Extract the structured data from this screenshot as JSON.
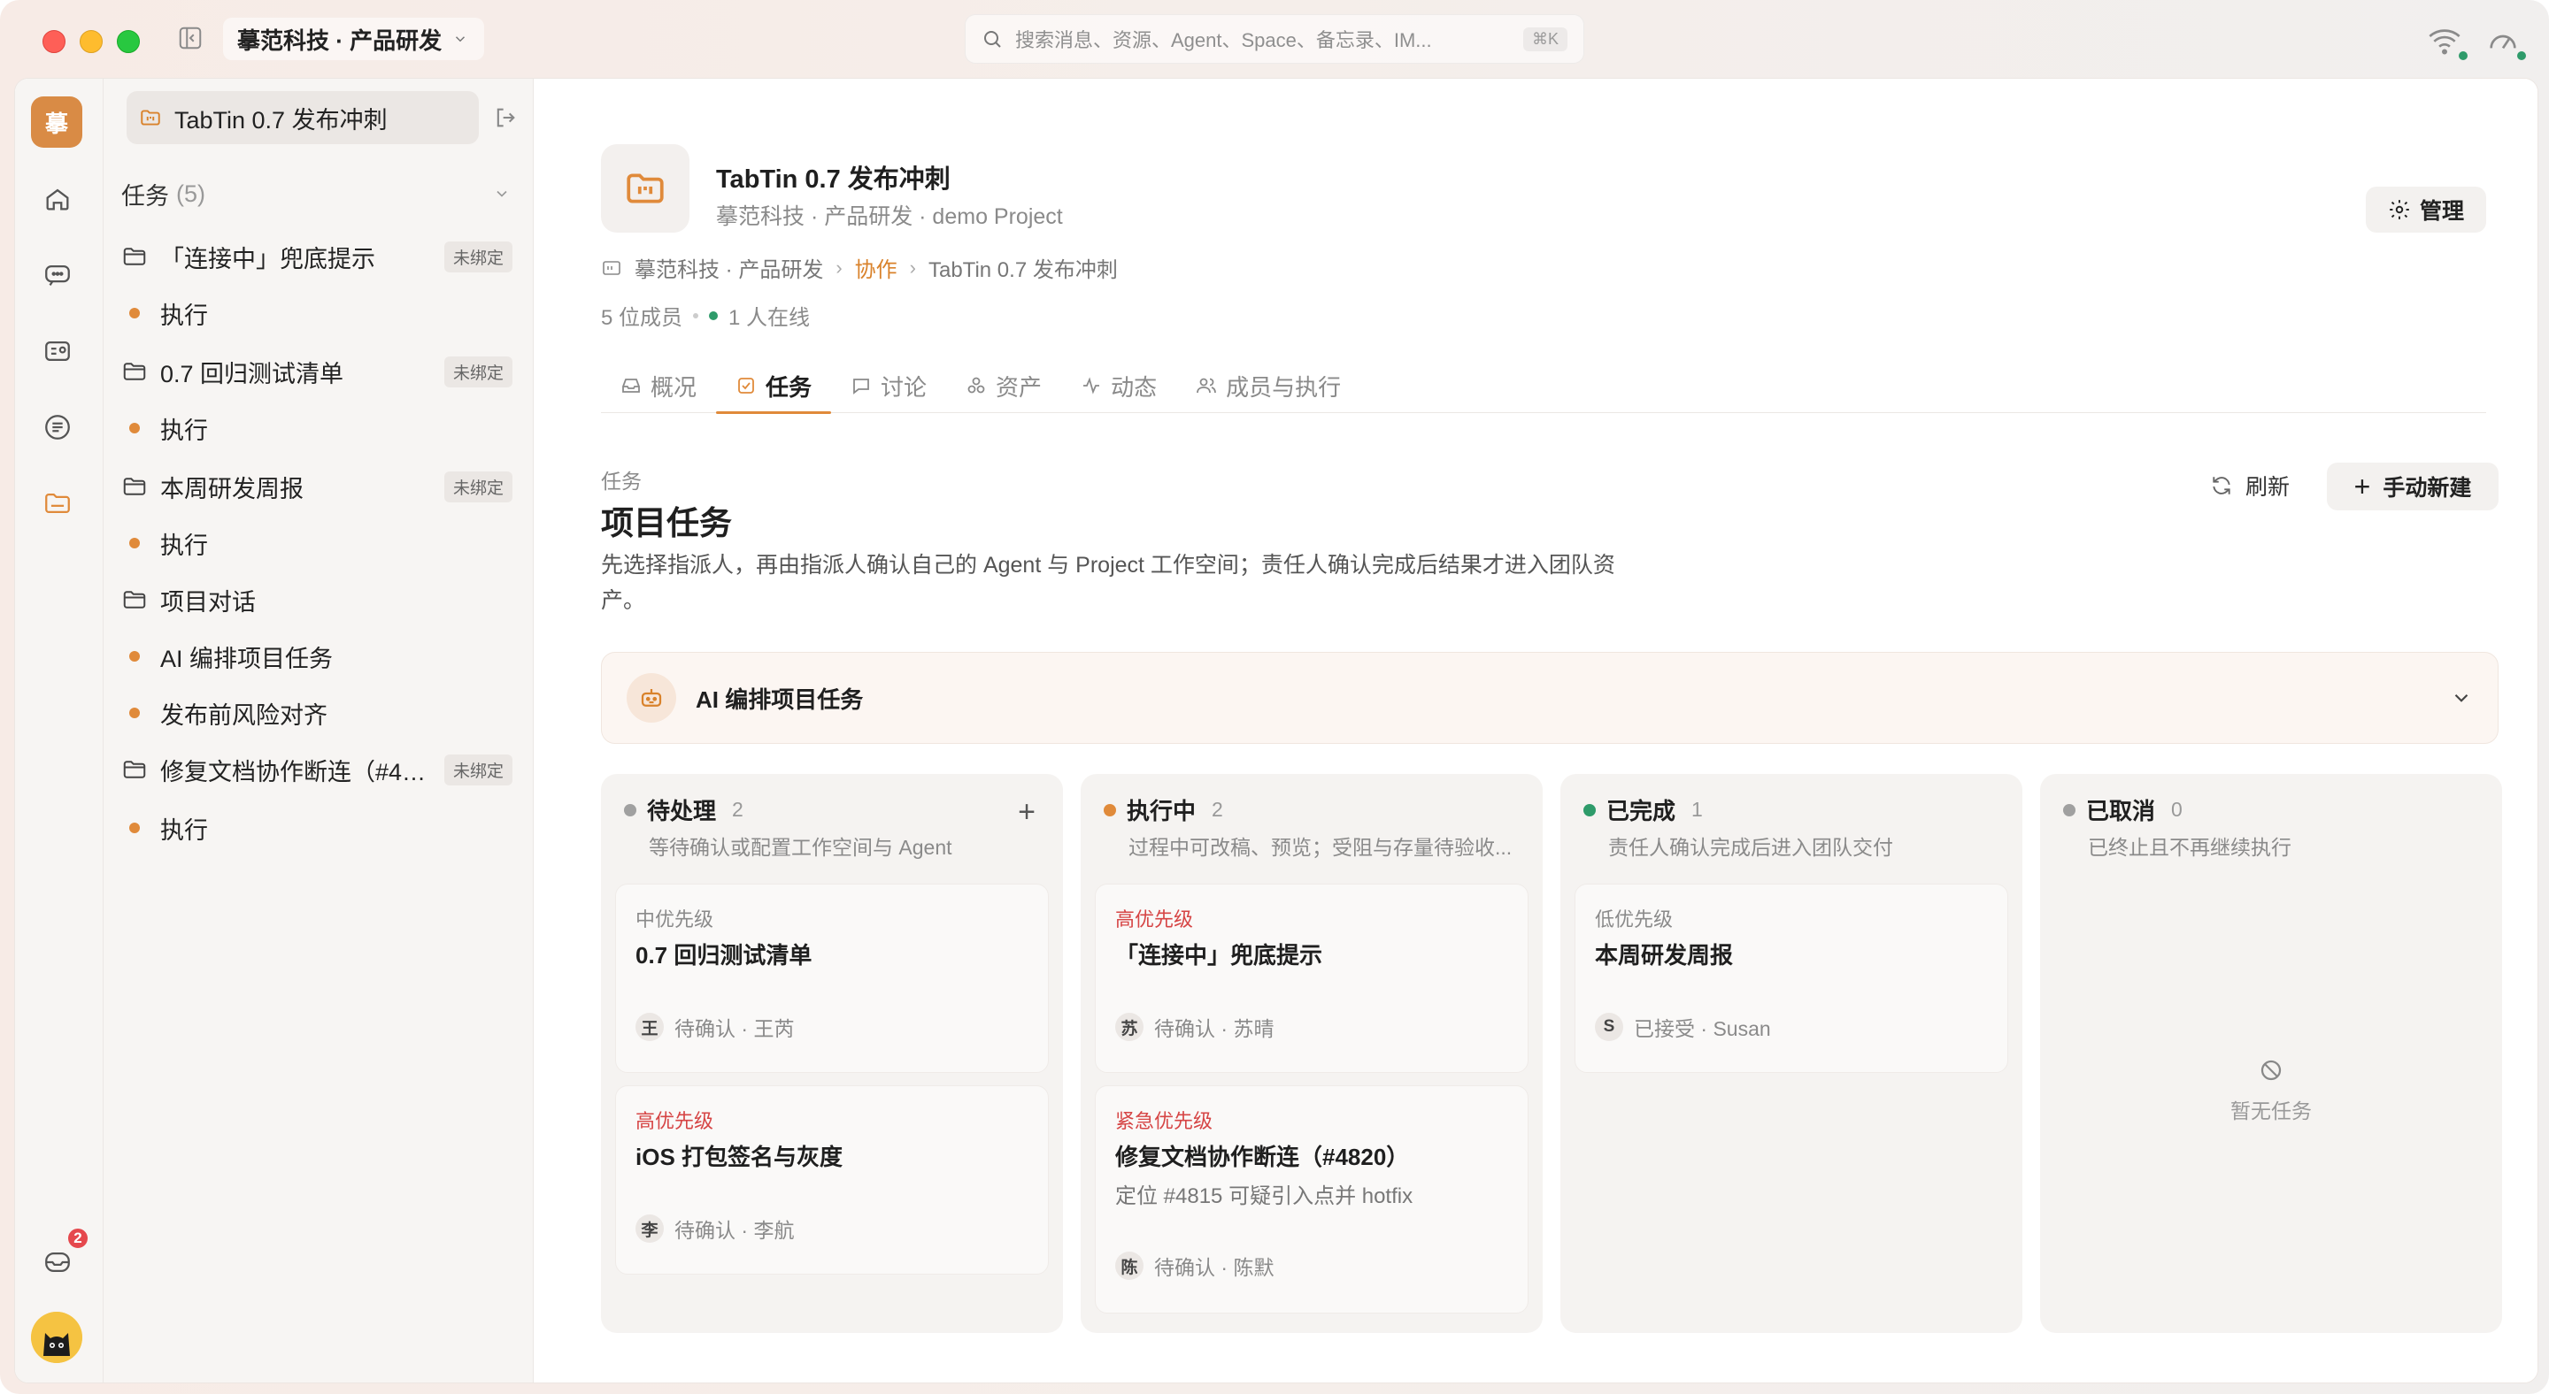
{
  "titlebar": {
    "workspace": "摹范科技 · 产品研发",
    "search_placeholder": "搜索消息、资源、Agent、Space、备忘录、IM...",
    "search_shortcut": "⌘K"
  },
  "rail": {
    "workspace_initial": "摹",
    "inbox_badge": "2"
  },
  "sidebar": {
    "project": "TabTin 0.7 发布冲刺",
    "section_label": "任务",
    "section_count": "(5)",
    "items": [
      {
        "type": "folder",
        "label": "「连接中」兜底提示",
        "tag": "未绑定"
      },
      {
        "type": "run",
        "label": "执行"
      },
      {
        "type": "folder",
        "label": "0.7 回归测试清单",
        "tag": "未绑定"
      },
      {
        "type": "run",
        "label": "执行"
      },
      {
        "type": "folder",
        "label": "本周研发周报",
        "tag": "未绑定"
      },
      {
        "type": "run",
        "label": "执行"
      },
      {
        "type": "folder",
        "label": "项目对话"
      },
      {
        "type": "run",
        "label": "AI 编排项目任务"
      },
      {
        "type": "run",
        "label": "发布前风险对齐"
      },
      {
        "type": "folder",
        "label": "修复文档协作断连（#4…",
        "tag": "未绑定"
      },
      {
        "type": "run",
        "label": "执行"
      }
    ]
  },
  "header": {
    "title": "TabTin 0.7 发布冲刺",
    "subtitle": "摹范科技 · 产品研发 · demo Project",
    "manage_label": "管理",
    "breadcrumb": [
      "摹范科技 · 产品研发",
      "协作",
      "TabTin 0.7 发布冲刺"
    ],
    "members": "5 位成员",
    "online": "1 人在线"
  },
  "tabs": [
    {
      "label": "概况",
      "icon": "inbox-icon"
    },
    {
      "label": "任务",
      "icon": "checkbox-icon",
      "active": true
    },
    {
      "label": "讨论",
      "icon": "chat-icon"
    },
    {
      "label": "资产",
      "icon": "assets-icon"
    },
    {
      "label": "动态",
      "icon": "activity-icon"
    },
    {
      "label": "成员与执行",
      "icon": "members-icon"
    }
  ],
  "tasks_section": {
    "kicker": "任务",
    "title": "项目任务",
    "description": "先选择指派人，再由指派人确认自己的 Agent 与 Project 工作空间；责任人确认完成后结果才进入团队资产。",
    "refresh_label": "刷新",
    "new_label": "手动新建"
  },
  "ai_panel": {
    "label": "AI 编排项目任务"
  },
  "columns": [
    {
      "name": "待处理",
      "count": "2",
      "color": "#a0a0a0",
      "desc": "等待确认或配置工作空间与 Agent",
      "cards": [
        {
          "priority": "中优先级",
          "prio_class": "p-mid",
          "title": "0.7 回归测试清单",
          "avatar": "王",
          "status": "待确认 · 王芮"
        },
        {
          "priority": "高优先级",
          "prio_class": "p-high",
          "title": "iOS 打包签名与灰度",
          "avatar": "李",
          "status": "待确认 · 李航"
        }
      ]
    },
    {
      "name": "执行中",
      "count": "2",
      "color": "#e08a3a",
      "desc": "过程中可改稿、预览；受阻与存量待验收...",
      "cards": [
        {
          "priority": "高优先级",
          "prio_class": "p-high",
          "title": "「连接中」兜底提示",
          "avatar": "苏",
          "status": "待确认 · 苏晴"
        },
        {
          "priority": "紧急优先级",
          "prio_class": "p-urgent",
          "title": "修复文档协作断连（#4820）",
          "note": "定位 #4815 可疑引入点并 hotfix",
          "avatar": "陈",
          "status": "待确认 · 陈默"
        }
      ]
    },
    {
      "name": "已完成",
      "count": "1",
      "color": "#2e9b6a",
      "desc": "责任人确认完成后进入团队交付",
      "cards": [
        {
          "priority": "低优先级",
          "prio_class": "p-low",
          "title": "本周研发周报",
          "avatar": "S",
          "status": "已接受 · Susan"
        }
      ]
    },
    {
      "name": "已取消",
      "count": "0",
      "color": "#a0a0a0",
      "desc": "已终止且不再继续执行",
      "empty": "暂无任务",
      "cards": []
    }
  ]
}
